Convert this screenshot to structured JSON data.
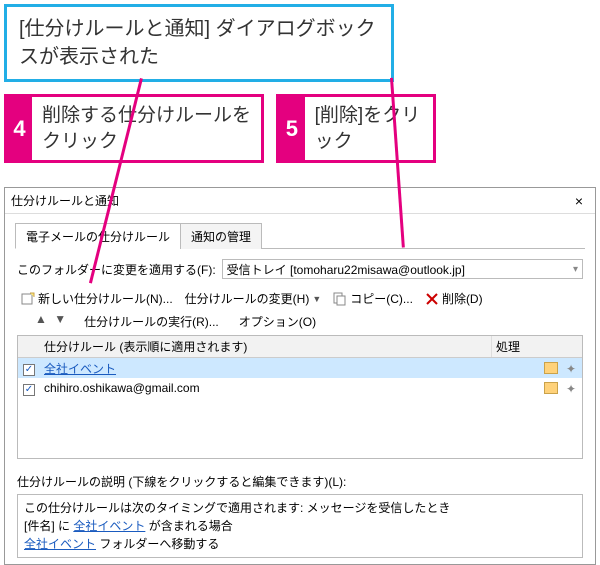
{
  "callout_top": "[仕分けルールと通知] ダイアログボックスが表示された",
  "step4": {
    "num": "4",
    "text": "削除する仕分けルールをクリック"
  },
  "step5": {
    "num": "5",
    "text": "[削除]をクリック"
  },
  "dialog": {
    "title": "仕分けルールと通知",
    "close": "×",
    "tabs": {
      "active": "電子メールの仕分けルール",
      "other": "通知の管理"
    },
    "folder_label": "このフォルダーに変更を適用する(F):",
    "folder_value": "受信トレイ [tomoharu22misawa@outlook.jp]",
    "toolbar": {
      "new": "新しい仕分けルール(N)...",
      "change": "仕分けルールの変更(H)",
      "copy": "コピー(C)...",
      "delete": "削除(D)"
    },
    "updown": "▲  ▼",
    "sub": {
      "run": "仕分けルールの実行(R)...",
      "opt": "オプション(O)"
    },
    "table": {
      "col_rule": "仕分けルール (表示順に適用されます)",
      "col_action": "処理",
      "rows": [
        {
          "checked": true,
          "label": "全社イベント",
          "link": true,
          "selected": true
        },
        {
          "checked": true,
          "label": "chihiro.oshikawa@gmail.com",
          "link": false,
          "selected": false
        }
      ]
    },
    "desc_label": "仕分けルールの説明 (下線をクリックすると編集できます)(L):",
    "desc_lines": {
      "l1": "この仕分けルールは次のタイミングで適用されます: メッセージを受信したとき",
      "l2a": "[件名] に ",
      "l2b": "全社イベント",
      "l2c": " が含まれる場合",
      "l3a": "全社イベント",
      "l3b": " フォルダーへ移動する"
    }
  }
}
